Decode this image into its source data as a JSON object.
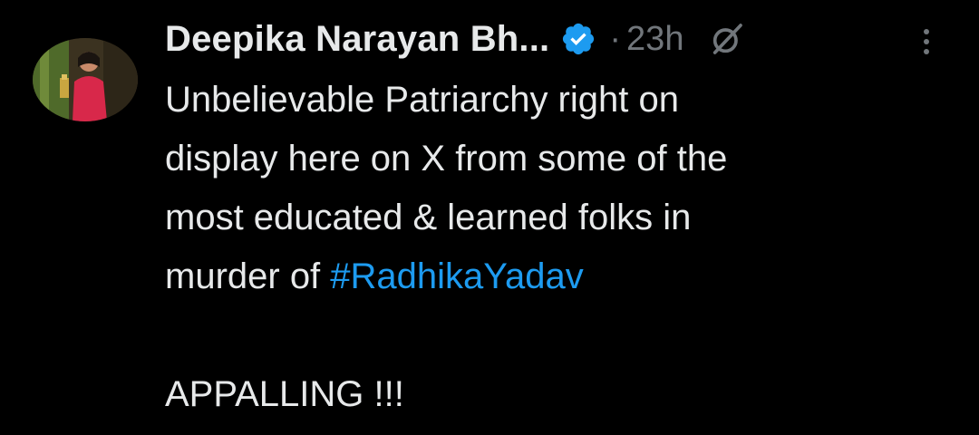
{
  "author": {
    "name": "Deepika Narayan Bh...",
    "verified_icon": "verified-badge-icon",
    "verified_color": "#1d9bf0",
    "time_separator": "·",
    "time": "23h"
  },
  "body": {
    "line1": "Unbelievable Patriarchy right on",
    "line2": "display here on X from some of the",
    "line3": "most educated & learned folks in",
    "line4_prefix": "murder of ",
    "hashtag": "#RadhikaYadav",
    "line6": "APPALLING !!!"
  },
  "icons": {
    "grok": "grok-icon",
    "more": "more-options-icon"
  },
  "colors": {
    "background": "#000000",
    "text": "#e7e9ea",
    "muted": "#71767b",
    "link": "#1d9bf0"
  }
}
